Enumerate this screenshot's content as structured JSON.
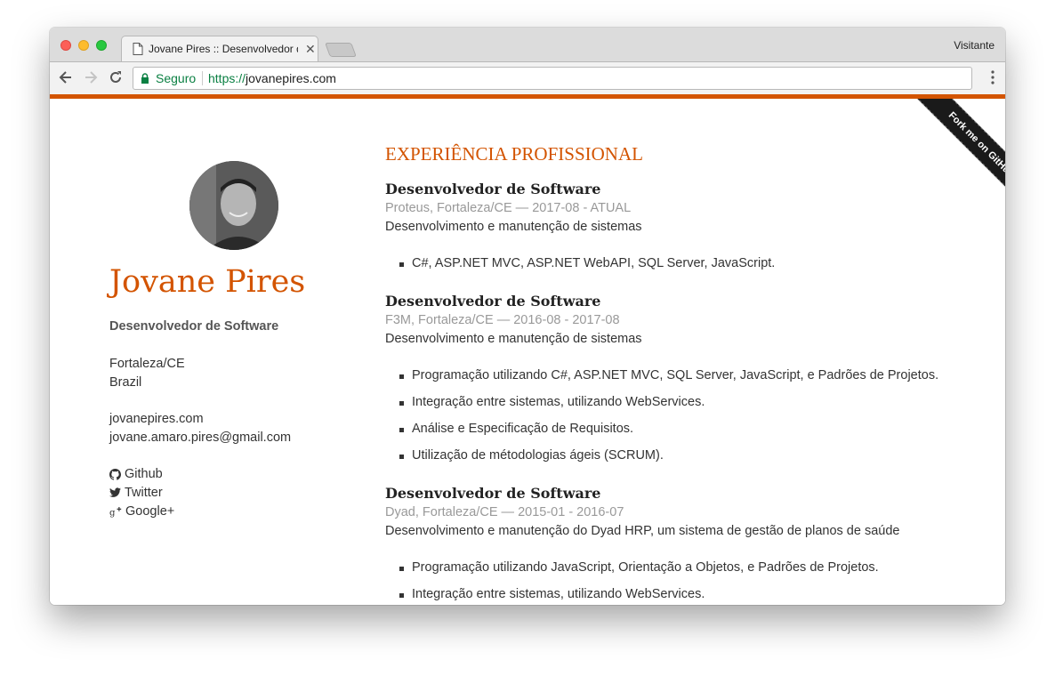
{
  "browser": {
    "tab_title": "Jovane Pires :: Desenvolvedor de Software",
    "profile_name": "Visitante",
    "secure_label": "Seguro",
    "url_scheme": "https://",
    "url_host": "jovanepires.com"
  },
  "colors": {
    "accent": "#d35400"
  },
  "sidebar": {
    "name": "Jovane Pires",
    "job": "Desenvolvedor de Software",
    "city": "Fortaleza/CE",
    "country": "Brazil",
    "website": "jovanepires.com",
    "email": "jovane.amaro.pires@gmail.com",
    "links": [
      {
        "icon": "github-icon",
        "label": "Github"
      },
      {
        "icon": "twitter-icon",
        "label": "Twitter"
      },
      {
        "icon": "google-plus-icon",
        "label": "Google+"
      }
    ]
  },
  "ribbon": {
    "label": "Fork me on GitHub"
  },
  "experience": {
    "section_title": "EXPERIÊNCIA PROFISSIONAL",
    "jobs": [
      {
        "title": "Desenvolvedor de Software",
        "meta": "Proteus, Fortaleza/CE  —  2017-08 - ATUAL",
        "description": "Desenvolvimento e manutenção de sistemas",
        "bullets": [
          "C#, ASP.NET MVC, ASP.NET WebAPI, SQL Server, JavaScript."
        ]
      },
      {
        "title": "Desenvolvedor de Software",
        "meta": "F3M, Fortaleza/CE  —  2016-08 - 2017-08",
        "description": "Desenvolvimento e manutenção de sistemas",
        "bullets": [
          "Programação utilizando C#, ASP.NET MVC, SQL Server, JavaScript, e Padrões de Projetos.",
          "Integração entre sistemas, utilizando WebServices.",
          "Análise e Especificação de Requisitos.",
          "Utilização de métodologias ágeis (SCRUM)."
        ]
      },
      {
        "title": "Desenvolvedor de Software",
        "meta": "Dyad, Fortaleza/CE  —  2015-01 - 2016-07",
        "description": "Desenvolvimento e manutenção do Dyad HRP, um sistema de gestão de planos de saúde",
        "bullets": [
          "Programação utilizando JavaScript, Orientação a Objetos, e Padrões de Projetos.",
          "Integração entre sistemas, utilizando WebServices."
        ]
      }
    ]
  }
}
